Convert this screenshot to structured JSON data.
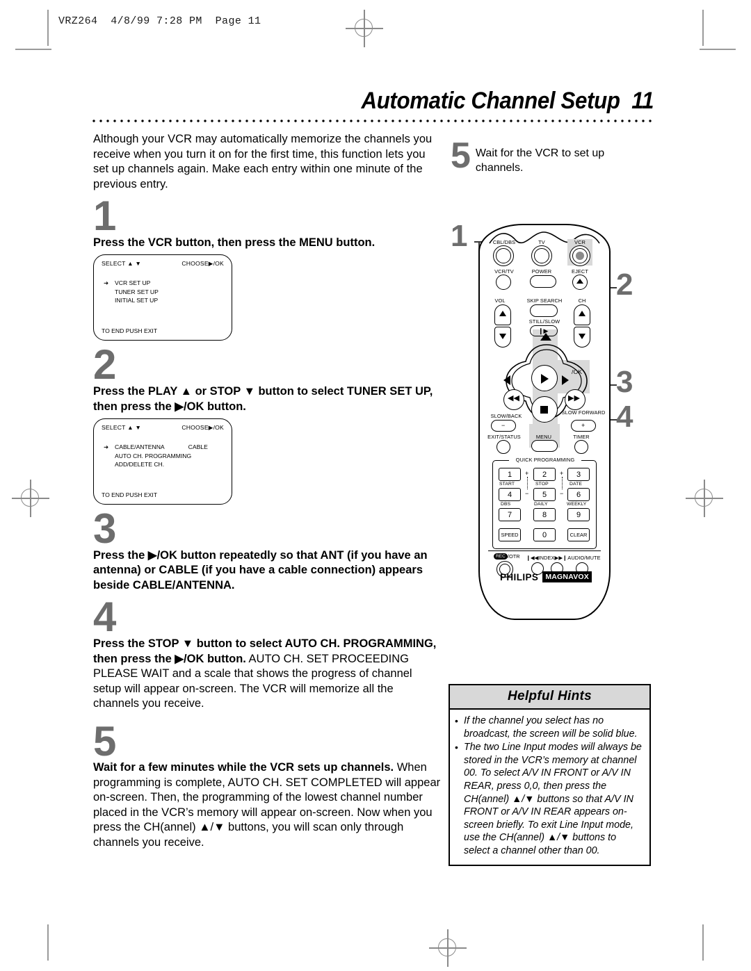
{
  "print": {
    "slug": "VRZ264  4/8/99 7:28 PM  Page 11"
  },
  "header": {
    "title": "Automatic Channel Setup",
    "page_number": "11"
  },
  "intro": "Although your VCR may automatically memorize the channels you receive when you turn it on for the first time, this function lets you set up channels again.  Make each entry within one minute of the previous entry.",
  "steps": [
    {
      "number": "1",
      "lead": "Press the VCR button, then press the MENU button.",
      "body": "",
      "osd": {
        "select_label": "SELECT",
        "select_arrows": "▲ ▼",
        "choose_label": "CHOOSE",
        "choose_arrows": "▶/OK",
        "rows": [
          {
            "arrow": "➜",
            "label": "VCR SET UP",
            "value": ""
          },
          {
            "arrow": "",
            "label": "TUNER SET UP",
            "value": ""
          },
          {
            "arrow": "",
            "label": "INITIAL SET UP",
            "value": ""
          }
        ],
        "footer": "TO END PUSH EXIT"
      }
    },
    {
      "number": "2",
      "lead": "Press the PLAY ▲ or STOP ▼ button to select TUNER SET UP, then press the ▶/OK button.",
      "body": "",
      "osd": {
        "select_label": "SELECT",
        "select_arrows": "▲ ▼",
        "choose_label": "CHOOSE",
        "choose_arrows": "▶/OK",
        "rows": [
          {
            "arrow": "➜",
            "label": "CABLE/ANTENNA",
            "value": "CABLE"
          },
          {
            "arrow": "",
            "label": "AUTO CH. PROGRAMMING",
            "value": ""
          },
          {
            "arrow": "",
            "label": "ADD/DELETE CH.",
            "value": ""
          }
        ],
        "footer": "TO END PUSH EXIT"
      }
    },
    {
      "number": "3",
      "lead": "Press the ▶/OK button repeatedly so that ANT (if you have an antenna) or CABLE (if you have a cable connection) appears beside CABLE/ANTENNA.",
      "body": ""
    },
    {
      "number": "4",
      "lead": "Press the STOP ▼ button to select AUTO CH. PROGRAMMING, then press the ▶/OK button.",
      "body": "AUTO CH. SET PROCEEDING PLEASE WAIT and a scale that shows the progress of channel setup will appear on-screen. The VCR will memorize all the channels you receive."
    },
    {
      "number": "5",
      "lead": "Wait for a few minutes while the VCR sets up channels.",
      "body": "When programming is complete, AUTO CH. SET COMPLETED will appear on-screen. Then, the programming of the lowest channel number placed in the VCR’s memory will appear on-screen. Now when you press the CH(annel) ▲/▼ buttons, you will scan only through channels you receive."
    }
  ],
  "right_step": {
    "number": "5",
    "text": "Wait for the VCR to set up channels."
  },
  "callouts": [
    {
      "number": "1"
    },
    {
      "number": "2"
    },
    {
      "number": "3"
    },
    {
      "number": "4"
    }
  ],
  "hints": {
    "title": "Helpful Hints",
    "bullet": "•",
    "items": [
      "If the channel you select has no broadcast, the screen will be solid blue.",
      "The two Line Input modes will always be stored in the VCR’s memory at channel 00. To select A/V IN FRONT or A/V IN REAR, press 0,0, then press the CH(annel) ▲/▼ buttons so that A/V IN FRONT or A/V IN REAR appears on-screen briefly. To exit Line Input mode, use the CH(annel) ▲/▼ buttons to select a channel other than 00."
    ]
  },
  "remote": {
    "brand": "PHILIPS",
    "sub_brand": "MAGNAVOX",
    "labels": {
      "cbl_dbs": "CBL/DBS",
      "tv": "TV",
      "vcr": "VCR",
      "vcr_tv": "VCR/TV",
      "power": "POWER",
      "eject": "EJECT",
      "vol": "VOL",
      "skip_search": "SKIP SEARCH",
      "ch": "CH",
      "still_slow": "STILL/SLOW",
      "play": "PLAY",
      "ok": "/OK",
      "stop": "STOP",
      "slow_back": "SLOW/BACK",
      "slow_forward": "SLOW FORWARD",
      "exit_status": "EXIT/STATUS",
      "menu": "MENU",
      "timer": "TIMER",
      "quick_programming": "QUICK PROGRAMMING",
      "rec": "REC",
      "otr": "/OTR",
      "index": "INDEX",
      "audio_mute": "AUDIO/MUTE",
      "minus": "−",
      "plus": "+"
    },
    "keypad": [
      {
        "key": "1",
        "sub": "START"
      },
      {
        "key": "2",
        "sub": "STOP"
      },
      {
        "key": "3",
        "sub": "DATE"
      },
      {
        "key": "4",
        "sub": "DBS"
      },
      {
        "key": "5",
        "sub": "DAILY"
      },
      {
        "key": "6",
        "sub": "WEEKLY"
      },
      {
        "key": "7",
        "sub": ""
      },
      {
        "key": "8",
        "sub": ""
      },
      {
        "key": "9",
        "sub": ""
      },
      {
        "key": "SPEED",
        "sub": ""
      },
      {
        "key": "0",
        "sub": ""
      },
      {
        "key": "CLEAR",
        "sub": ""
      }
    ]
  }
}
